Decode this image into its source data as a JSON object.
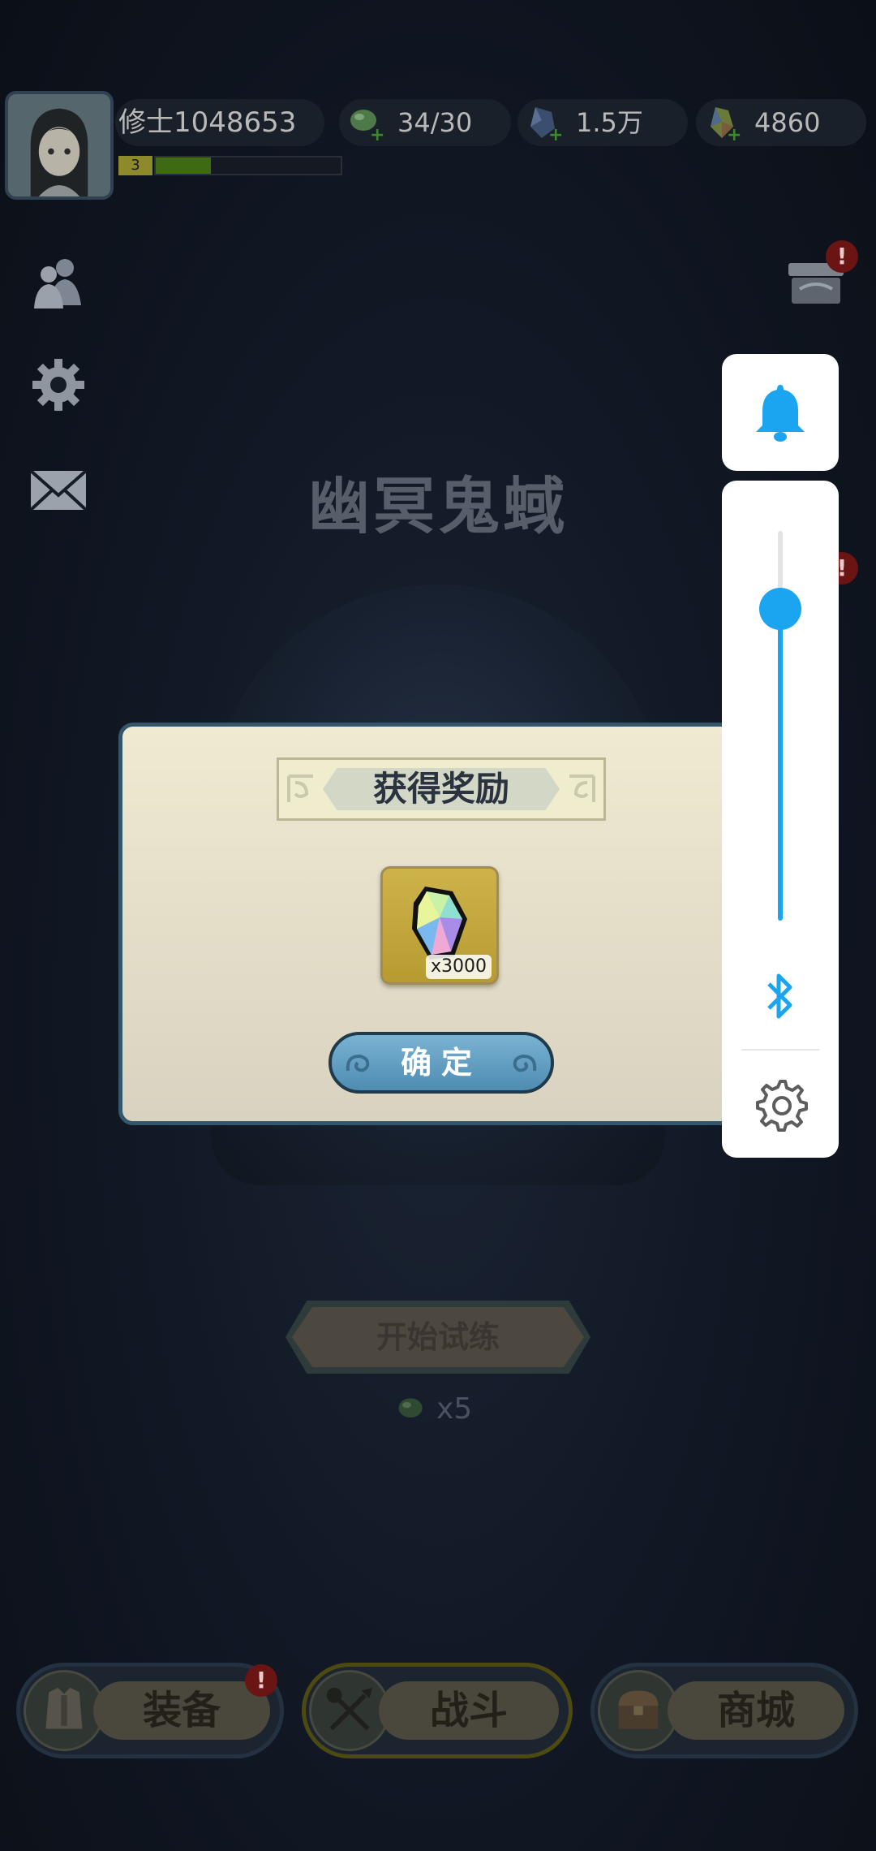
{
  "header": {
    "player_name": "修士1048653",
    "level": "3",
    "xp_fraction": 0.3,
    "resources": {
      "stamina": "34/30",
      "crystal": "1.5万",
      "gem": "4860"
    }
  },
  "scene": {
    "area_title": "幽冥鬼蜮",
    "start_button": "开始试练",
    "start_cost": "x5",
    "alert_mark": "!"
  },
  "bottom_nav": {
    "equip": "装备",
    "battle": "战斗",
    "shop": "商城"
  },
  "dialog": {
    "title": "获得奖励",
    "reward_qty": "x3000",
    "confirm_label": "确定"
  },
  "volume_overlay": {
    "level_fraction": 0.8,
    "accent_color": "#1ba4ef",
    "icons": [
      "bell-icon",
      "bluetooth-icon",
      "settings-icon"
    ]
  }
}
